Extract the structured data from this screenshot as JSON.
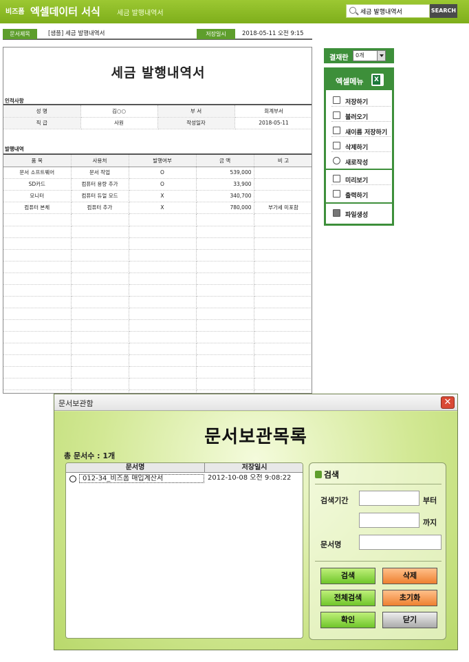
{
  "header": {
    "brand": "비즈폼",
    "app_title": "엑셀데이터 서식",
    "subtitle": "세금 발행내역서",
    "search_value": "세금 발행내역서",
    "search_button": "SEARCH"
  },
  "docinfo": {
    "title_tag": "문서제목",
    "title_value": "[샘플] 세금 발행내역서",
    "date_tag": "저장일시",
    "date_value": "2018-05-11  오전 9:15"
  },
  "sheet": {
    "title": "세금 발행내역서",
    "personal_label": "인적사항",
    "personal_rows": [
      [
        "성  명",
        "김○○",
        "부  서",
        "회계부서"
      ],
      [
        "직  급",
        "사원",
        "작성일자",
        "2018-05-11"
      ]
    ],
    "issue_label": "발행내역",
    "columns": [
      "품  목",
      "사용처",
      "발행여부",
      "금  액",
      "비  고"
    ],
    "rows": [
      [
        "문서 소프트웨어",
        "문서 작업",
        "O",
        "539,000",
        ""
      ],
      [
        "SD카드",
        "컴퓨터 용량 추가",
        "O",
        "33,900",
        ""
      ],
      [
        "모니터",
        "컴퓨터 듀얼 모드",
        "X",
        "340,700",
        ""
      ],
      [
        "컴퓨터 본체",
        "컴퓨터 추가",
        "X",
        "780,000",
        "부가세 미포함"
      ]
    ]
  },
  "right": {
    "pay_label": "결재란",
    "pay_value": "0개",
    "menu_title": "엑셀메뉴",
    "menu_group1": [
      "저장하기",
      "불러오기",
      "새이름 저장하기",
      "삭제하기",
      "새로작성"
    ],
    "menu_group2": [
      "미리보기",
      "출력하기"
    ],
    "menu_group3": [
      "파일생성"
    ]
  },
  "dialog": {
    "title": "문서보관함",
    "close": "✕",
    "big_title": "문서보관목록",
    "count": "총 문서수 : 1개",
    "col_name": "문서명",
    "col_date": "저장일시",
    "rows": [
      {
        "name": "012-34_비즈폼 매입계산서",
        "date": "2012-10-08 오전 9:08:22"
      }
    ],
    "search_title": "검색",
    "period_label": "검색기간",
    "from_label": "부터",
    "to_label": "까지",
    "name_label": "문서명",
    "buttons": {
      "search": "검색",
      "delete": "삭제",
      "search_all": "전체검색",
      "reset": "초기화",
      "ok": "확인",
      "close": "닫기"
    }
  }
}
